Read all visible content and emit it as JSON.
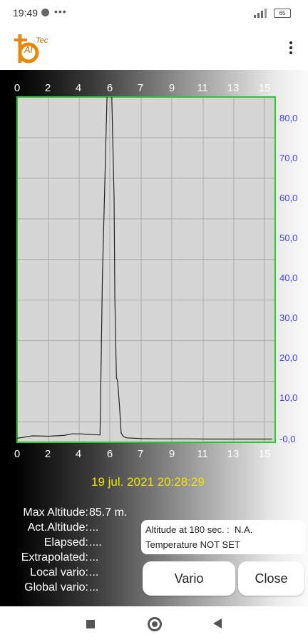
{
  "status_bar": {
    "time": "19:49",
    "dots": "•••",
    "battery": "65"
  },
  "app_bar": {
    "logo_text": "AlTec",
    "menu_icon": "more-vert-icon"
  },
  "chart_data": {
    "type": "line",
    "x_ticks": [
      "0",
      "2",
      "4",
      "6",
      "7",
      "9",
      "11",
      "13",
      "15"
    ],
    "y_ticks": [
      "80,0",
      "70,0",
      "60,0",
      "50,0",
      "40,0",
      "30,0",
      "20,0",
      "10,0",
      "-0,0"
    ],
    "xlim": [
      0,
      16.5
    ],
    "ylim": [
      -0.8,
      85
    ],
    "grid": true,
    "line_color": "#222222",
    "frame_color": "#22cc22",
    "tick_color_y": "#3f3fff",
    "x": [
      0,
      1,
      2,
      3,
      3.5,
      4,
      5.3,
      5.45,
      5.75,
      5.9,
      6.05,
      6.2,
      6.25,
      6.35,
      6.42,
      6.55,
      6.65,
      6.8,
      7.0,
      7.5,
      8,
      9,
      10,
      11,
      12,
      13,
      14,
      15,
      16.3
    ],
    "y": [
      0.2,
      0.8,
      0.7,
      0.9,
      1.3,
      1.3,
      1.0,
      40.0,
      85.7,
      85.7,
      85.7,
      60.0,
      35.0,
      15.2,
      14.5,
      8.0,
      1.5,
      0.6,
      0.3,
      0.2,
      0.1,
      0.05,
      0.05,
      0.05,
      0.0,
      0.0,
      0.0,
      0.0,
      0.0
    ]
  },
  "date": "19 jul. 2021 20:28:29",
  "info": [
    {
      "label": "Max Altitude:",
      "value": "85.7 m."
    },
    {
      "label": "Act.Altitude:",
      "value": "..."
    },
    {
      "label": "Elapsed:",
      "value": "...."
    },
    {
      "label": "Extrapolated:",
      "value": "..."
    },
    {
      "label": "Local vario:",
      "value": "..."
    },
    {
      "label": "Global vario:",
      "value": "..."
    }
  ],
  "panel": {
    "altitude_at": "Altitude at 180 sec. :",
    "altitude_value": "N.A.",
    "temperature": "Temperature NOT SET"
  },
  "buttons": {
    "vario": "Vario",
    "close": "Close"
  },
  "nav": {
    "recents_icon": "recents-icon",
    "home_icon": "home-icon",
    "back_icon": "back-icon"
  }
}
